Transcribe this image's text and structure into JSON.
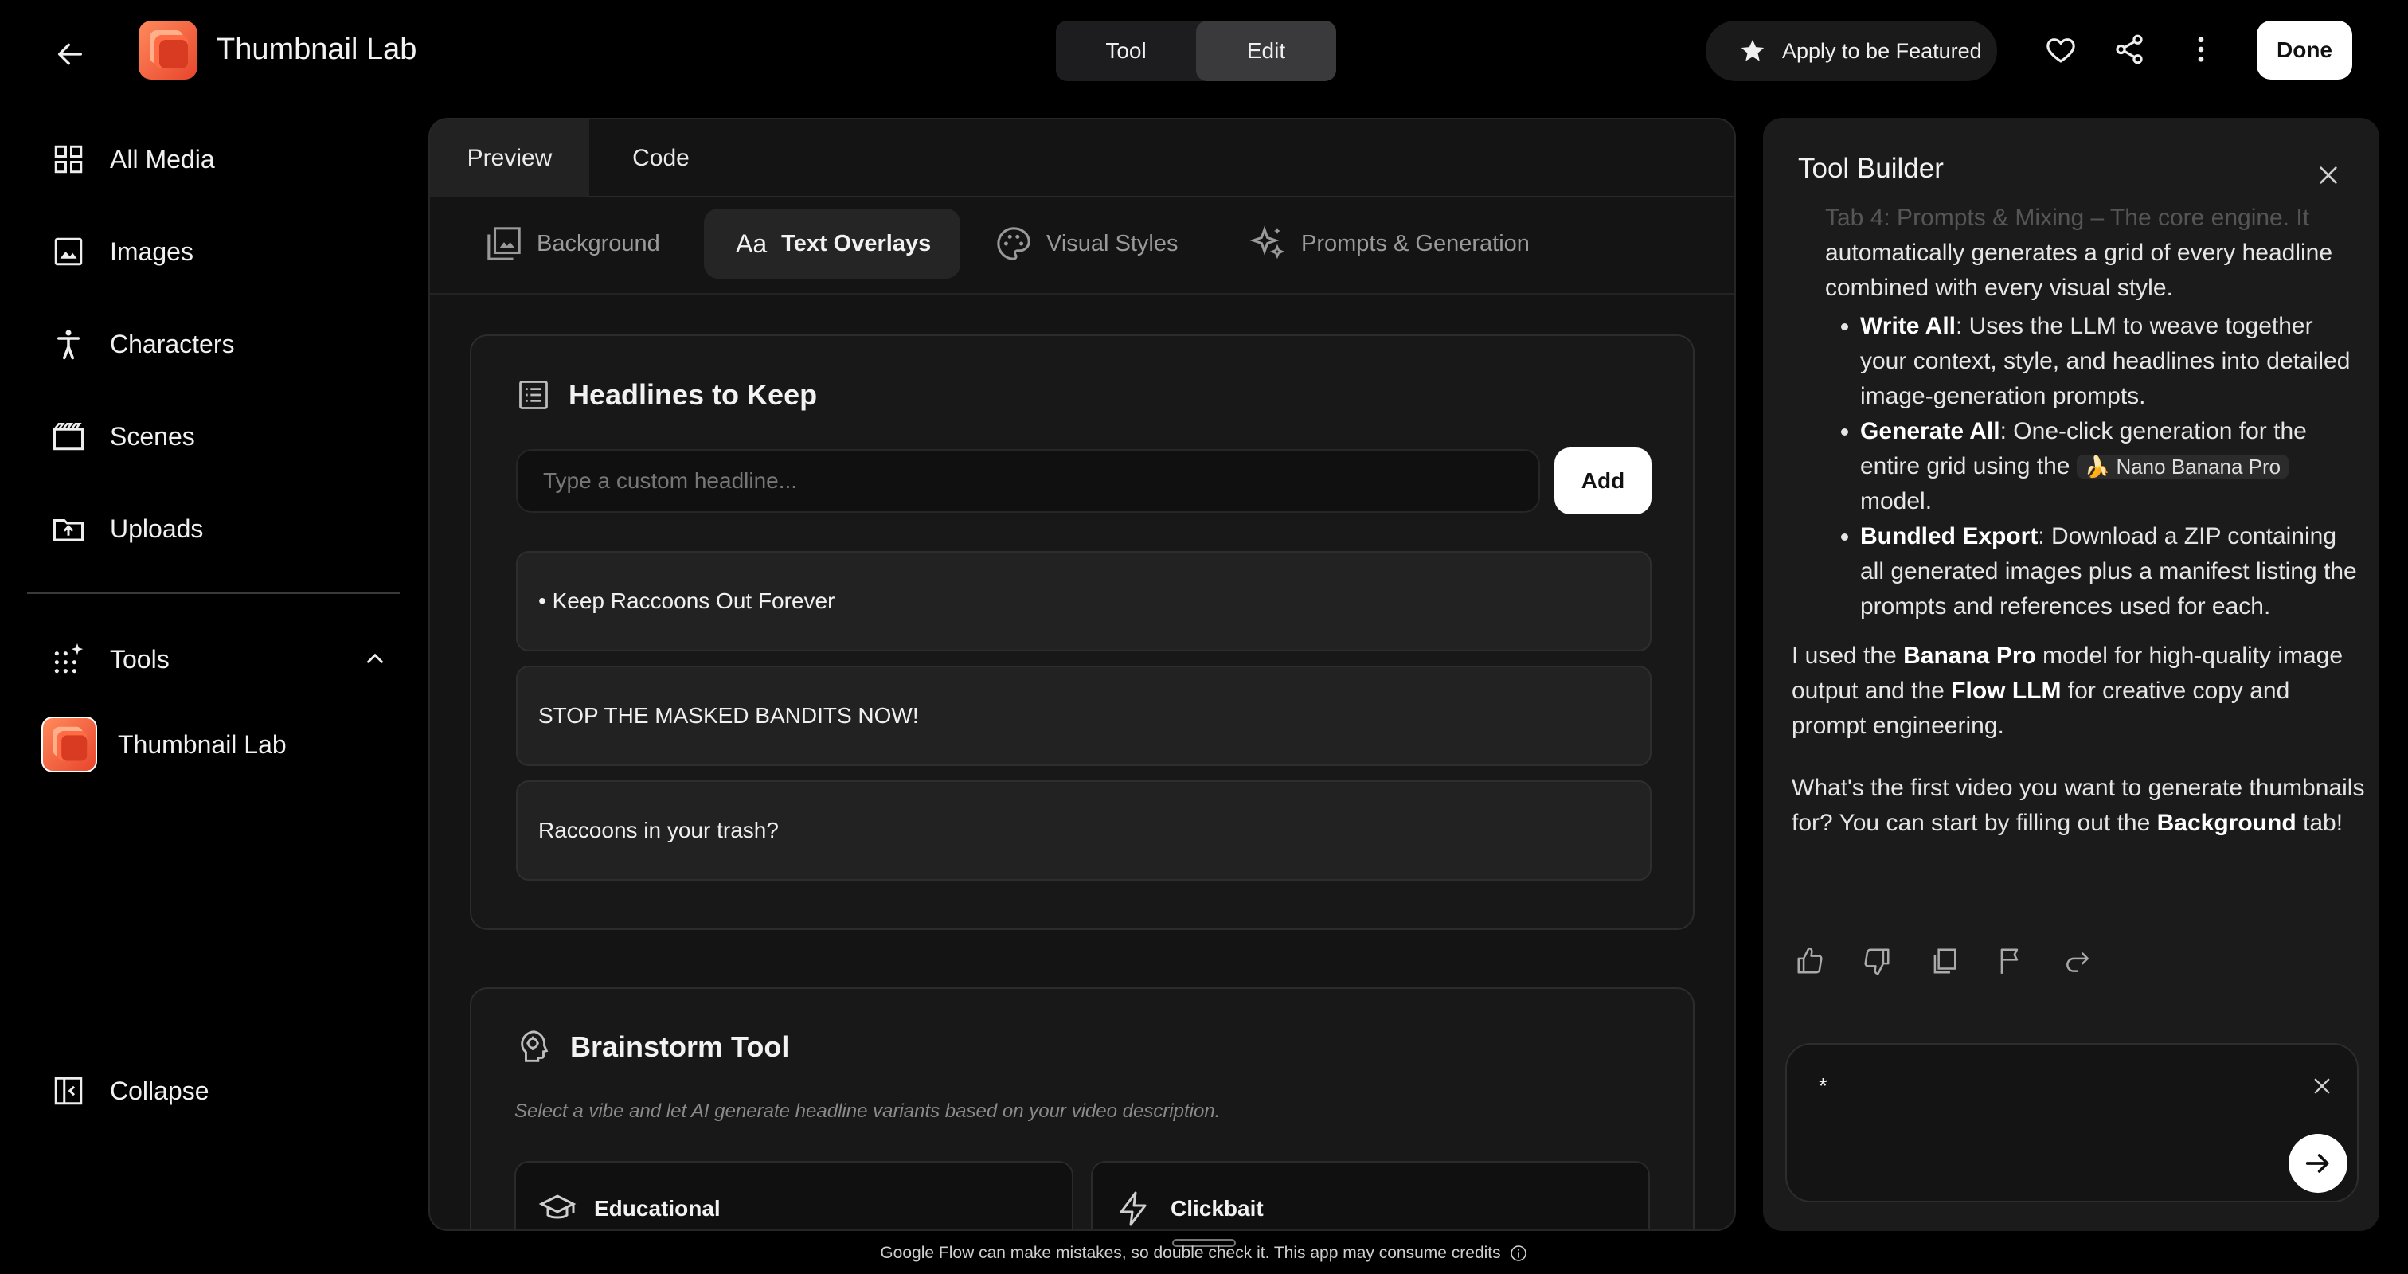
{
  "header": {
    "app_title": "Thumbnail Lab",
    "modes": [
      "Tool",
      "Edit"
    ],
    "active_mode": "Edit",
    "featured_label": "Apply to be Featured",
    "done_label": "Done"
  },
  "sidebar": {
    "items": [
      {
        "label": "All Media",
        "icon": "grid-icon"
      },
      {
        "label": "Images",
        "icon": "image-icon"
      },
      {
        "label": "Characters",
        "icon": "person-icon"
      },
      {
        "label": "Scenes",
        "icon": "clapperboard-icon"
      },
      {
        "label": "Uploads",
        "icon": "upload-folder-icon"
      }
    ],
    "tools_label": "Tools",
    "tool_item": "Thumbnail Lab",
    "collapse_label": "Collapse"
  },
  "main": {
    "view_tabs": [
      "Preview",
      "Code"
    ],
    "active_view": "Preview",
    "sub_tabs": [
      "Background",
      "Text Overlays",
      "Visual Styles",
      "Prompts & Generation"
    ],
    "active_sub_tab": "Text Overlays",
    "headlines": {
      "title": "Headlines to Keep",
      "input_placeholder": "Type a custom headline...",
      "add_label": "Add",
      "items": [
        "• Keep Raccoons Out Forever",
        "STOP THE MASKED BANDITS NOW!",
        "Raccoons in your trash?"
      ]
    },
    "brainstorm": {
      "title": "Brainstorm Tool",
      "description": "Select a vibe and let AI generate headline variants based on your video description.",
      "vibes": [
        "Educational",
        "Clickbait"
      ]
    }
  },
  "builder": {
    "title": "Tool Builder",
    "faded_line": "Tab 4: Prompts & Mixing – The core engine. It",
    "intro": "automatically generates a grid of every headline combined with every visual style.",
    "bullets": [
      {
        "bold": "Write All",
        "text": ": Uses the LLM to weave together your context, style, and headlines into detailed image-generation prompts."
      },
      {
        "bold": "Generate All",
        "text": ": One-click generation for the entire grid using the",
        "chip": "🍌 Nano Banana Pro",
        "tail": "model."
      },
      {
        "bold": "Bundled Export",
        "text": ": Download a ZIP containing all generated images plus a manifest listing the prompts and references used for each."
      }
    ],
    "para1_a": "I used the ",
    "para1_b": "Banana Pro",
    "para1_c": " model for high-quality image output and the ",
    "para1_d": "Flow LLM",
    "para1_e": " for creative copy and prompt engineering.",
    "para2_a": "What's the first video you want to generate thumbnails for? You can start by filling out the ",
    "para2_b": "Background",
    "para2_c": " tab!",
    "input_value": "*"
  },
  "footer": {
    "disclaimer": "Google Flow can make mistakes, so double check it. This app may consume credits"
  }
}
